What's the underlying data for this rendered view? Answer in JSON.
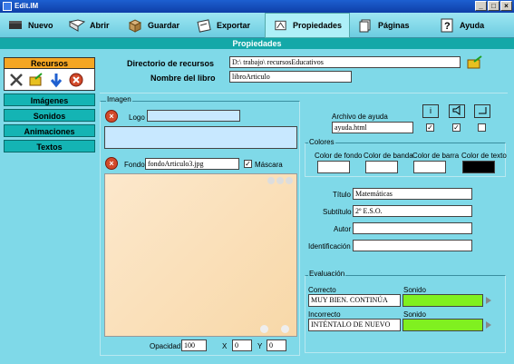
{
  "window": {
    "title": "Edit.IM"
  },
  "toolbar": {
    "items": [
      {
        "label": "Nuevo"
      },
      {
        "label": "Abrir"
      },
      {
        "label": "Guardar"
      },
      {
        "label": "Exportar"
      },
      {
        "label": "Propiedades"
      },
      {
        "label": "Páginas"
      },
      {
        "label": "Ayuda"
      }
    ]
  },
  "section": {
    "title": "Propiedades"
  },
  "sidebar": {
    "header": "Recursos",
    "items": [
      "Imágenes",
      "Sonidos",
      "Animaciones",
      "Textos"
    ]
  },
  "resources": {
    "dir_label": "Directorio de recursos",
    "dir_value": "D:\\ trabajo\\ recursosEducativos",
    "book_label": "Nombre del libro",
    "book_value": "libroArticulo"
  },
  "imagen": {
    "group_label": "Imagen",
    "logo_label": "Logo",
    "fondo_label": "Fondo",
    "fondo_value": "fondoArticulo3.jpg",
    "mascara_label": "Máscara",
    "mascara_checked": "✓",
    "opacidad_label": "Opacidad",
    "opacidad_value": "100",
    "x_label": "X",
    "x_value": "0",
    "y_label": "Y",
    "y_value": "0"
  },
  "ayuda": {
    "label": "Archivo de ayuda",
    "value": "ayuda.html",
    "check1": "✓",
    "check2": "✓",
    "icon1": "i"
  },
  "colores": {
    "group_label": "Colores",
    "fondo": "Color de fondo",
    "banda": "Color de banda",
    "barra": "Color de barra",
    "texto": "Color de texto"
  },
  "meta": {
    "titulo_label": "Título",
    "titulo_value": "Matemáticas",
    "subtitulo_label": "Subtítulo",
    "subtitulo_value": "2º E.S.O.",
    "autor_label": "Autor",
    "autor_value": "",
    "id_label": "Identificación",
    "id_value": ""
  },
  "evaluacion": {
    "group_label": "Evaluación",
    "correcto_label": "Correcto",
    "correcto_value": "MUY BIEN. CONTINÚA",
    "sonido1_label": "Sonido",
    "incorrecto_label": "Incorrecto",
    "incorrecto_value": "INTÉNTALO DE NUEVO",
    "sonido2_label": "Sonido"
  }
}
